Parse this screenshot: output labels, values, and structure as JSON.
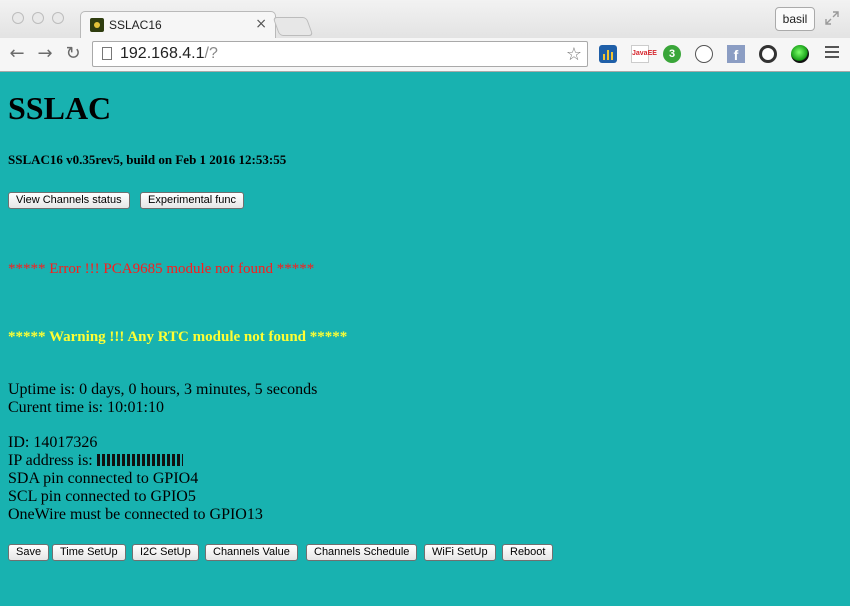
{
  "browser": {
    "tab_title": "SSLAC16",
    "tab_close": "×",
    "profile_name": "basil",
    "url_host": "192.168.4.1",
    "url_rest": "/?",
    "nav": {
      "back": "←",
      "forward": "→",
      "reload": "↻"
    },
    "star": "☆",
    "extensions": [
      {
        "icon": "bar-chart-extension-icon",
        "color": "#1f5fa8"
      },
      {
        "icon": "javaee-extension-icon",
        "text": "JavaEE",
        "color": "#d6262d"
      },
      {
        "icon": "badge-extension-icon",
        "text": "3",
        "color": "#3aa63a"
      },
      {
        "icon": "face-extension-icon",
        "color": "#555555"
      },
      {
        "icon": "facebook-extension-icon",
        "text": "f",
        "color": "#8b9dc3"
      },
      {
        "icon": "wheel-extension-icon",
        "color": "#333333"
      },
      {
        "icon": "green-dot-extension-icon",
        "color": "#2ec22e"
      }
    ]
  },
  "page": {
    "title": "SSLAC",
    "build": "SSLAC16 v0.35rev5, build on Feb 1 2016 12:53:55",
    "top_buttons": [
      "View Channels status",
      "Experimental func"
    ],
    "error": "***** Error !!! PCA9685 module not found *****",
    "warning": "***** Warning !!! Any RTC module not found *****",
    "uptime": "Uptime is: 0 days, 0 hours, 3 minutes, 5 seconds",
    "current_time": "Curent time is: 10:01:10",
    "id": "ID: 14017326",
    "ip_label": "IP address is: ",
    "sda": "SDA pin connected to GPIO4",
    "scl": "SCL pin connected to GPIO5",
    "onewire": "OneWire must be connected to GPIO13",
    "bottom_buttons": [
      "Save",
      "Time SetUp",
      "I2C SetUp",
      "Channels Value",
      "Channels Schedule",
      "WiFi SetUp",
      "Reboot"
    ],
    "colors": {
      "background": "#18b2b0",
      "error": "#ff1a1a",
      "warning": "#ffff33"
    }
  }
}
